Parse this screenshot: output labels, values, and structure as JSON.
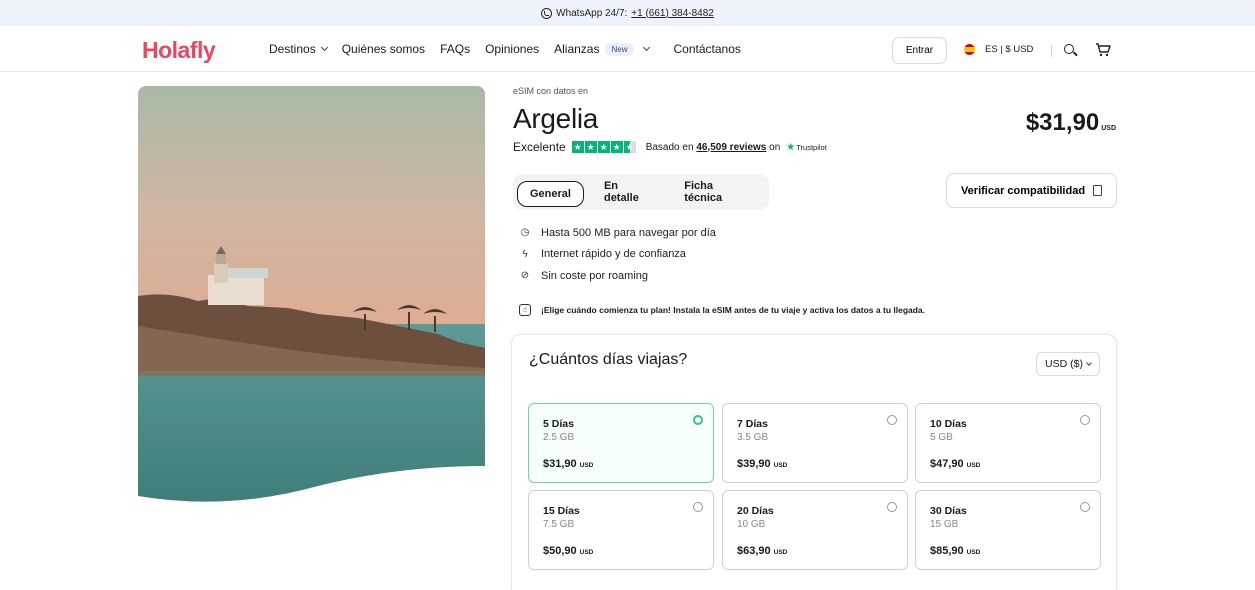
{
  "topbar": {
    "whatsapp_label": "WhatsApp 24/7:",
    "phone": "+1 (661) 384-8482"
  },
  "brand": {
    "logo": "Holafly",
    "accent": "#e8485f"
  },
  "nav": {
    "destinos": "Destinos",
    "quienes": "Quiénes somos",
    "faqs": "FAQs",
    "opiniones": "Opiniones",
    "alianzas": "Alianzas",
    "new_badge": "New",
    "contacto": "Contáctanos",
    "login": "Entrar",
    "lang": "ES | $ USD"
  },
  "product": {
    "eyebrow": "eSIM con datos en",
    "title": "Argelia",
    "price": "$31,90",
    "currency": "USD",
    "rating_label": "Excelente",
    "rating_stars": 4.5,
    "based_on": "Basado en",
    "reviews": "46,509 reviews",
    "on": "on",
    "trustpilot": "Trustpilot"
  },
  "tabs": [
    "General",
    "En detalle",
    "Ficha técnica"
  ],
  "verify_label": "Verificar compatibilidad",
  "features": [
    "Hasta 500 MB para navegar por día",
    "Internet rápido y de confianza",
    "Sin coste por roaming"
  ],
  "tip": "¡Elige cuándo comienza tu plan! Instala la eSIM antes de tu viaje y activa los datos a tu llegada.",
  "panel": {
    "question": "¿Cuántos días viajas?",
    "currency_select": "USD ($)",
    "plans": [
      {
        "days": "5 Días",
        "data": "2.5 GB",
        "price": "$31,90",
        "unit": "USD",
        "selected": true
      },
      {
        "days": "7 Días",
        "data": "3.5 GB",
        "price": "$39,90",
        "unit": "USD",
        "selected": false
      },
      {
        "days": "10 Días",
        "data": "5 GB",
        "price": "$47,90",
        "unit": "USD",
        "selected": false
      },
      {
        "days": "15 Días",
        "data": "7.5 GB",
        "price": "$50,90",
        "unit": "USD",
        "selected": false
      },
      {
        "days": "20 Días",
        "data": "10 GB",
        "price": "$63,90",
        "unit": "USD",
        "selected": false
      },
      {
        "days": "30 Días",
        "data": "15 GB",
        "price": "$85,90",
        "unit": "USD",
        "selected": false
      }
    ]
  }
}
